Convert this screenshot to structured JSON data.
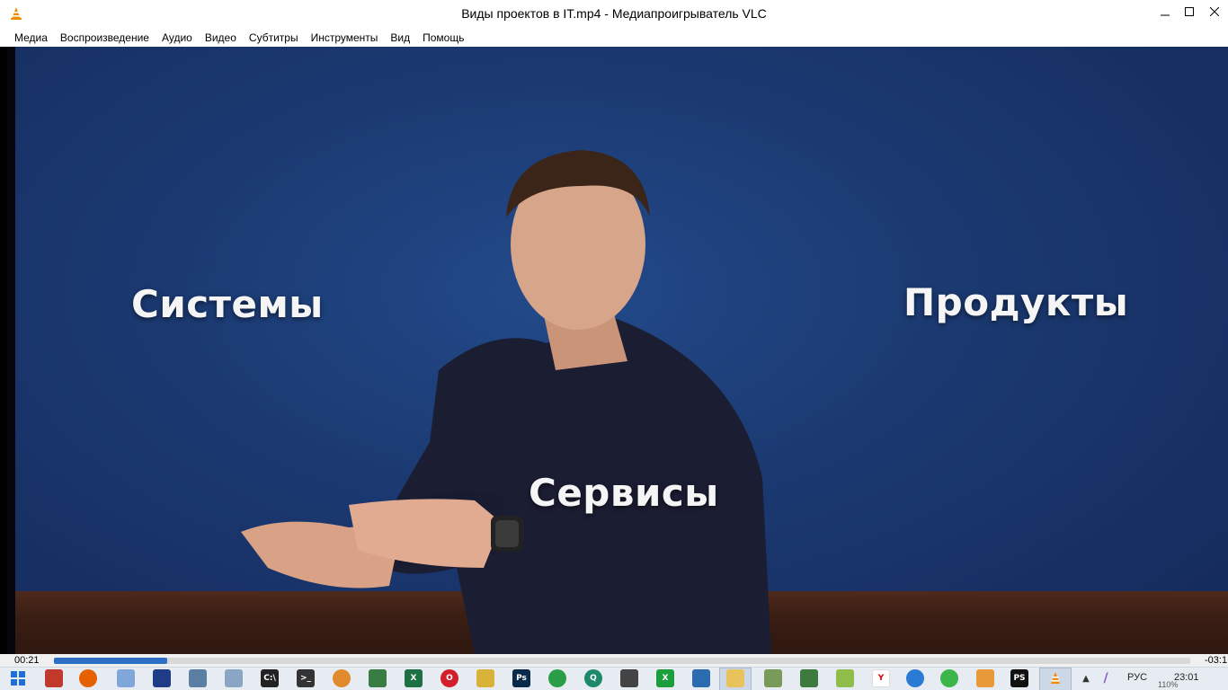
{
  "window": {
    "title": "Виды проектов в IT.mp4 - Медиапроигрыватель VLC"
  },
  "menu": [
    "Медиа",
    "Воспроизведение",
    "Аудио",
    "Видео",
    "Субтитры",
    "Инструменты",
    "Вид",
    "Помощь"
  ],
  "video": {
    "captions": {
      "left": "Системы",
      "right": "Продукты",
      "center": "Сервисы"
    },
    "colors": {
      "background": "#1c3a6e",
      "floor": "#3a1e14",
      "shirt": "#1b1d33"
    }
  },
  "playback": {
    "elapsed": "00:21",
    "remaining": "-03:1",
    "progress_fraction": 0.1
  },
  "tray": {
    "language": "РУС",
    "time": "23:01",
    "zoom": "110%"
  },
  "taskbar_icons": [
    "windows-start-icon",
    "app-icon",
    "firefox-icon",
    "app-icon",
    "save-icon",
    "app-icon",
    "app-icon",
    "terminal-icon",
    "terminal-icon",
    "butterfly-icon",
    "app-icon",
    "excel-icon",
    "opera-icon",
    "app-icon",
    "photoshop-icon",
    "chrome-icon",
    "app-icon",
    "app-icon",
    "app-icon",
    "app-icon",
    "folder-icon",
    "app-icon",
    "app-icon",
    "notepad-icon",
    "yandex-icon",
    "edge-icon",
    "app-icon",
    "app-icon",
    "phpstorm-icon",
    "vlc-icon"
  ]
}
